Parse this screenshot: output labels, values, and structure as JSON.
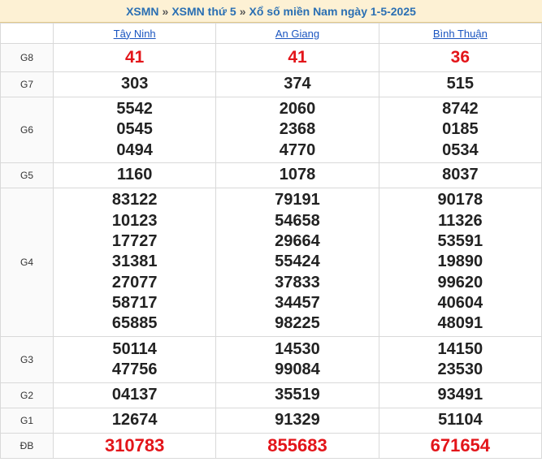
{
  "header": {
    "crumb1": "XSMN",
    "crumb2": "XSMN thứ 5",
    "crumb3": "Xổ số miền Nam ngày 1-5-2025",
    "separator": "»"
  },
  "provinces": [
    "Tây Ninh",
    "An Giang",
    "Bình Thuận"
  ],
  "colors": {
    "accent": "#2a6fb3",
    "special": "#e3151a",
    "header_bg": "#fdf1d4"
  },
  "rows": [
    {
      "label": "G8",
      "values": [
        [
          "41"
        ],
        [
          "41"
        ],
        [
          "36"
        ]
      ]
    },
    {
      "label": "G7",
      "values": [
        [
          "303"
        ],
        [
          "374"
        ],
        [
          "515"
        ]
      ]
    },
    {
      "label": "G6",
      "values": [
        [
          "5542",
          "0545",
          "0494"
        ],
        [
          "2060",
          "2368",
          "4770"
        ],
        [
          "8742",
          "0185",
          "0534"
        ]
      ]
    },
    {
      "label": "G5",
      "values": [
        [
          "1160"
        ],
        [
          "1078"
        ],
        [
          "8037"
        ]
      ]
    },
    {
      "label": "G4",
      "values": [
        [
          "83122",
          "10123",
          "17727",
          "31381",
          "27077",
          "58717",
          "65885"
        ],
        [
          "79191",
          "54658",
          "29664",
          "55424",
          "37833",
          "34457",
          "98225"
        ],
        [
          "90178",
          "11326",
          "53591",
          "19890",
          "99620",
          "40604",
          "48091"
        ]
      ]
    },
    {
      "label": "G3",
      "values": [
        [
          "50114",
          "47756"
        ],
        [
          "14530",
          "99084"
        ],
        [
          "14150",
          "23530"
        ]
      ]
    },
    {
      "label": "G2",
      "values": [
        [
          "04137"
        ],
        [
          "35519"
        ],
        [
          "93491"
        ]
      ]
    },
    {
      "label": "G1",
      "values": [
        [
          "12674"
        ],
        [
          "91329"
        ],
        [
          "51104"
        ]
      ]
    },
    {
      "label": "ĐB",
      "values": [
        [
          "310783"
        ],
        [
          "855683"
        ],
        [
          "671654"
        ]
      ]
    }
  ]
}
